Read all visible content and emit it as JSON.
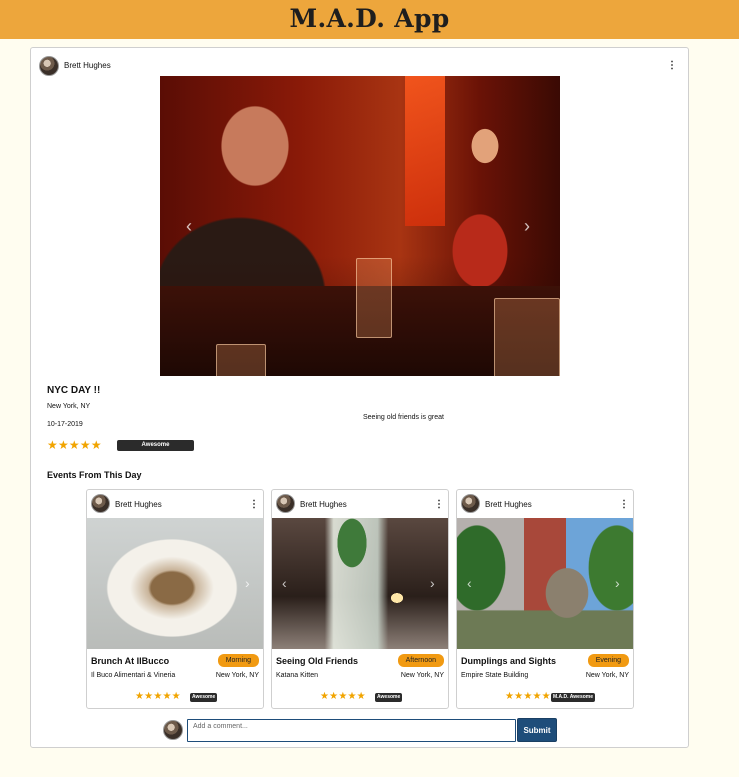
{
  "app": {
    "title": "M.A.D. App"
  },
  "post": {
    "author": "Brett Hughes",
    "title": "NYC DAY !!",
    "location": "New York, NY",
    "date": "10-17-2019",
    "description": "Seeing old friends is great",
    "rating": 4.5,
    "rating_stars": "★★★★★",
    "rating_label": "Awesome",
    "menu_icon": "⋮",
    "prev_icon": "‹",
    "next_icon": "›"
  },
  "events": {
    "section_title": "Events From This Day",
    "items": [
      {
        "author": "Brett Hughes",
        "title": "Brunch At IlBucco",
        "time_of_day": "Morning",
        "place": "Il Buco Alimentari & Vineria",
        "city": "New York, NY",
        "rating": 4.5,
        "rating_stars": "★★★★★",
        "rating_label": "Awesome"
      },
      {
        "author": "Brett Hughes",
        "title": "Seeing Old Friends",
        "time_of_day": "Afternoon",
        "place": "Katana Kitten",
        "city": "New York, NY",
        "rating": 4.5,
        "rating_stars": "★★★★★",
        "rating_label": "Awesome"
      },
      {
        "author": "Brett Hughes",
        "title": "Dumplings and Sights",
        "time_of_day": "Evening",
        "place": "Empire State Building",
        "city": "New York, NY",
        "rating": 5,
        "rating_stars": "★★★★★",
        "rating_label": "M.A.D. Awesome"
      }
    ]
  },
  "comment": {
    "placeholder": "Add a comment...",
    "submit_label": "Submit"
  },
  "colors": {
    "header": "#eda63c",
    "star": "#f1a400",
    "time_badge": "#f19a12",
    "submit": "#1e4d7a",
    "rating_badge": "#2b2b2b"
  }
}
